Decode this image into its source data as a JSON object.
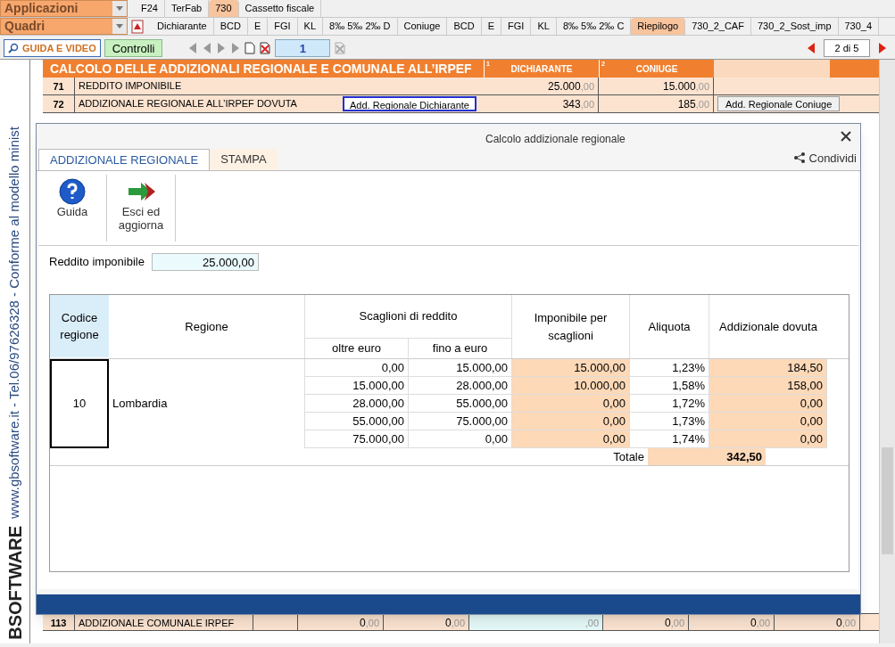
{
  "menus": [
    {
      "label": "Applicazioni",
      "tabs": [
        {
          "label": "F24",
          "selected": false
        },
        {
          "label": "TerFab",
          "selected": false
        },
        {
          "label": "730",
          "selected": true
        },
        {
          "label": "Cassetto fiscale",
          "selected": false
        }
      ]
    },
    {
      "label": "Quadri",
      "tabs": [
        {
          "label": "Dichiarante",
          "selected": false
        },
        {
          "label": "BCD",
          "selected": false
        },
        {
          "label": "E",
          "selected": false
        },
        {
          "label": "FGI",
          "selected": false
        },
        {
          "label": "KL",
          "selected": false
        },
        {
          "label": "8‰ 5‰ 2‰ D",
          "selected": false
        },
        {
          "label": "Coniuge",
          "selected": false
        },
        {
          "label": "BCD",
          "selected": false
        },
        {
          "label": "E",
          "selected": false
        },
        {
          "label": "FGI",
          "selected": false
        },
        {
          "label": "KL",
          "selected": false
        },
        {
          "label": "8‰ 5‰ 2‰ C",
          "selected": false
        },
        {
          "label": "Riepilogo",
          "selected": true
        },
        {
          "label": "730_2_CAF",
          "selected": false
        },
        {
          "label": "730_2_Sost_imp",
          "selected": false
        },
        {
          "label": "730_4",
          "selected": false
        }
      ]
    }
  ],
  "toolbar": {
    "guide": "GUIDA E VIDEO",
    "checks": "Controlli",
    "record": "1",
    "pager": "2 di 5"
  },
  "side_strip": {
    "text": "www.gbsoftware.it - Tel.06/97626328 - Conforme al modello minist",
    "logo": "BSOFTWARE"
  },
  "sheet": {
    "title": "CALCOLO DELLE ADDIZIONALI REGIONALE E COMUNALE ALL’IRPEF",
    "columns": [
      {
        "index": "1",
        "label": "DICHIARANTE"
      },
      {
        "index": "2",
        "label": "CONIUGE"
      }
    ],
    "rows": [
      {
        "number": "71",
        "label": "REDDITO IMPONIBILE",
        "values": [
          [
            "25.000",
            ",00"
          ],
          [
            "15.000",
            ",00"
          ]
        ]
      },
      {
        "number": "72",
        "label": "ADDIZIONALE REGIONALE ALL’IRPEF DOVUTA",
        "button": "Add. Regionale Dichiarante",
        "values": [
          [
            "343",
            ",00"
          ],
          [
            "185",
            ",00"
          ]
        ],
        "side_button": "Add. Regionale Coniuge"
      }
    ],
    "bottom_row": {
      "number": "113",
      "label": "ADDIZIONALE COMUNALE IRPEF",
      "values": [
        {
          "whole": "0",
          "decimals": ",00"
        },
        {
          "whole": "0",
          "decimals": ",00"
        },
        {
          "decimals": ",00"
        },
        {
          "whole": "0",
          "decimals": ",00"
        },
        {
          "whole": "0",
          "decimals": ",00"
        },
        {
          "whole": "0",
          "decimals": ",00"
        }
      ]
    }
  },
  "dialog": {
    "title": "Calcolo addizionale regionale",
    "tabs": [
      {
        "label": "ADDIZIONALE REGIONALE",
        "selected": true
      },
      {
        "label": "STAMPA",
        "selected": false
      }
    ],
    "share": "Condividi",
    "actions": [
      {
        "kind": "help",
        "label": "Guida"
      },
      {
        "kind": "exit",
        "label": "Esci ed aggiorna"
      }
    ],
    "income": {
      "label": "Reddito imponibile",
      "value": "25.000,00"
    },
    "table": {
      "headers": {
        "code": "Codice regione",
        "region": "Regione",
        "brackets": "Scaglioni di reddito",
        "from": "oltre euro",
        "to": "fino a euro",
        "taxable": "Imponibile per scaglioni",
        "rate": "Aliquota",
        "due": "Addizionale dovuta"
      },
      "code": "10",
      "region": "Lombardia",
      "rows": [
        [
          "0,00",
          "15.000,00",
          "15.000,00",
          "1,23%",
          "184,50"
        ],
        [
          "15.000,00",
          "28.000,00",
          "10.000,00",
          "1,58%",
          "158,00"
        ],
        [
          "28.000,00",
          "55.000,00",
          "0,00",
          "1,72%",
          "0,00"
        ],
        [
          "55.000,00",
          "75.000,00",
          "0,00",
          "1,73%",
          "0,00"
        ],
        [
          "75.000,00",
          "0,00",
          "0,00",
          "1,74%",
          "0,00"
        ]
      ],
      "total_label": "Totale",
      "total": "342,50"
    }
  }
}
